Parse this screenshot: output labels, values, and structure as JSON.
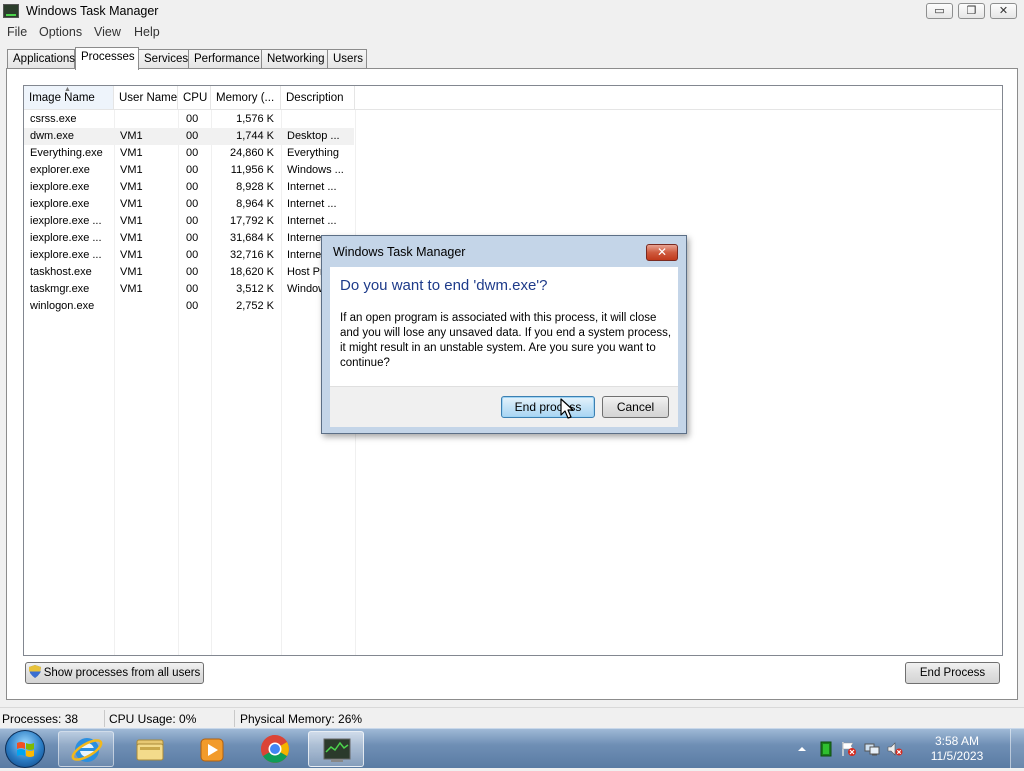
{
  "window": {
    "title": "Windows Task Manager",
    "controls": {
      "minimize": "▭",
      "maximize": "❐",
      "close": "✕"
    }
  },
  "menu": [
    "File",
    "Options",
    "View",
    "Help"
  ],
  "tabs": [
    "Applications",
    "Processes",
    "Services",
    "Performance",
    "Networking",
    "Users"
  ],
  "active_tab": "Processes",
  "process_list": {
    "columns": [
      "Image Name",
      "User Name",
      "CPU",
      "Memory (...",
      "Description"
    ],
    "rows": [
      {
        "image": "csrss.exe",
        "user": "",
        "cpu": "00",
        "memory": "1,576 K",
        "desc": ""
      },
      {
        "image": "dwm.exe",
        "user": "VM1",
        "cpu": "00",
        "memory": "1,744 K",
        "desc": "Desktop ..."
      },
      {
        "image": "Everything.exe",
        "user": "VM1",
        "cpu": "00",
        "memory": "24,860 K",
        "desc": "Everything"
      },
      {
        "image": "explorer.exe",
        "user": "VM1",
        "cpu": "00",
        "memory": "11,956 K",
        "desc": "Windows ..."
      },
      {
        "image": "iexplore.exe",
        "user": "VM1",
        "cpu": "00",
        "memory": "8,928 K",
        "desc": "Internet ..."
      },
      {
        "image": "iexplore.exe",
        "user": "VM1",
        "cpu": "00",
        "memory": "8,964 K",
        "desc": "Internet ..."
      },
      {
        "image": "iexplore.exe ...",
        "user": "VM1",
        "cpu": "00",
        "memory": "17,792 K",
        "desc": "Internet ..."
      },
      {
        "image": "iexplore.exe ...",
        "user": "VM1",
        "cpu": "00",
        "memory": "31,684 K",
        "desc": "Interne"
      },
      {
        "image": "iexplore.exe ...",
        "user": "VM1",
        "cpu": "00",
        "memory": "32,716 K",
        "desc": "Interne"
      },
      {
        "image": "taskhost.exe",
        "user": "VM1",
        "cpu": "00",
        "memory": "18,620 K",
        "desc": "Host Pr"
      },
      {
        "image": "taskmgr.exe",
        "user": "VM1",
        "cpu": "00",
        "memory": "3,512 K",
        "desc": "Window"
      },
      {
        "image": "winlogon.exe",
        "user": "",
        "cpu": "00",
        "memory": "2,752 K",
        "desc": ""
      }
    ],
    "selected_row": "dwm.exe"
  },
  "buttons": {
    "show_all_users": "Show processes from all users",
    "end_process": "End Process"
  },
  "status": {
    "processes": "Processes: 38",
    "cpu": "CPU Usage: 0%",
    "memory": "Physical Memory: 26%"
  },
  "dialog": {
    "title": "Windows Task Manager",
    "close": "✕",
    "heading": "Do you want to end 'dwm.exe'?",
    "message": "If an open program is associated with this process, it will close and you will lose any unsaved data. If you end a system process, it might result in an unstable system. Are you sure you want to continue?",
    "end_button": "End process",
    "cancel_button": "Cancel"
  },
  "taskbar": {
    "apps": [
      "internet-explorer-icon",
      "file-explorer-icon",
      "media-player-icon",
      "chrome-icon",
      "task-manager-icon"
    ],
    "tray_icons": [
      "show-hidden-icons-arrow",
      "network-activity-icon",
      "action-center-icon",
      "network-icon",
      "volume-muted-icon"
    ],
    "time": "3:58 AM",
    "date": "11/5/2023"
  },
  "colors": {
    "dialog_heading": "#1e3b8a",
    "dialog_frame": "#c4d5e8",
    "close_red": "#c03a1c",
    "taskbar": "#6f8fb5"
  }
}
